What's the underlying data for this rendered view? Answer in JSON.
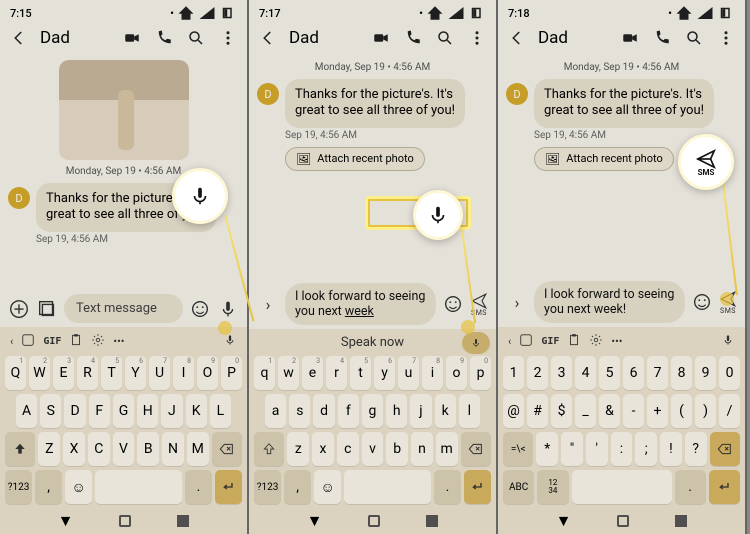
{
  "panels": [
    {
      "time": "7:15",
      "contact": "Dad",
      "timestamp": "Monday, Sep 19 • 4:56 AM",
      "msg": "Thanks for the picture's. It's great to see all three of you!",
      "subtime": "Sep 19, 4:56 AM",
      "composer_text": "Text message",
      "kbd_mode": "upper",
      "kbd_top_text": "",
      "callout": "mic"
    },
    {
      "time": "7:17",
      "contact": "Dad",
      "timestamp": "Monday, Sep 19 • 4:56 AM",
      "msg": "Thanks for the picture's. It's great to see all three of you!",
      "subtime": "Sep 19, 4:56 AM",
      "chip": "Attach recent photo",
      "composer_text": "I look forward to seeing you next ",
      "composer_underline": "week",
      "kbd_mode": "lower",
      "kbd_top_text": "Speak now",
      "callout": "mic"
    },
    {
      "time": "7:18",
      "contact": "Dad",
      "timestamp": "Monday, Sep 19 • 4:56 AM",
      "msg": "Thanks for the picture's. It's great to see all three of you!",
      "subtime": "Sep 19, 4:56 AM",
      "chip": "Attach recent photo",
      "composer_text": "I look forward to seeing you next week!",
      "kbd_mode": "numsym",
      "kbd_top_text": "",
      "callout": "send"
    }
  ],
  "send_label": "SMS",
  "avatar_letter": "D",
  "key_sets": {
    "upper": {
      "r1": [
        [
          "Q",
          "1"
        ],
        [
          "W",
          "2"
        ],
        [
          "E",
          "3"
        ],
        [
          "R",
          "4"
        ],
        [
          "T",
          "5"
        ],
        [
          "Y",
          "6"
        ],
        [
          "U",
          "7"
        ],
        [
          "I",
          "8"
        ],
        [
          "O",
          "9"
        ],
        [
          "P",
          "0"
        ]
      ],
      "r2": [
        "A",
        "S",
        "D",
        "F",
        "G",
        "H",
        "J",
        "K",
        "L"
      ],
      "r3": [
        "Z",
        "X",
        "C",
        "V",
        "B",
        "N",
        "M"
      ],
      "mode_key": "?123"
    },
    "lower": {
      "r1": [
        [
          "q",
          "1"
        ],
        [
          "w",
          "2"
        ],
        [
          "e",
          "3"
        ],
        [
          "r",
          "4"
        ],
        [
          "t",
          "5"
        ],
        [
          "y",
          "6"
        ],
        [
          "u",
          "7"
        ],
        [
          "i",
          "8"
        ],
        [
          "o",
          "9"
        ],
        [
          "p",
          "0"
        ]
      ],
      "r2": [
        "a",
        "s",
        "d",
        "f",
        "g",
        "h",
        "j",
        "k",
        "l"
      ],
      "r3": [
        "z",
        "x",
        "c",
        "v",
        "b",
        "n",
        "m"
      ],
      "mode_key": "?123"
    },
    "numsym": {
      "r1": [
        [
          "1",
          ""
        ],
        [
          "2",
          ""
        ],
        [
          "3",
          ""
        ],
        [
          "4",
          ""
        ],
        [
          "5",
          ""
        ],
        [
          "6",
          ""
        ],
        [
          "7",
          ""
        ],
        [
          "8",
          ""
        ],
        [
          "9",
          ""
        ],
        [
          "0",
          ""
        ]
      ],
      "r2": [
        "@",
        "#",
        "$",
        "_",
        "&",
        "-",
        "+",
        "(",
        ")",
        "/"
      ],
      "r3": [
        "*",
        "\"",
        "'",
        ":",
        ";",
        "!",
        "?"
      ],
      "mode_key": "ABC",
      "shift_key": "=\\<",
      "extra_key": "12\n34"
    }
  },
  "toolbar_icons": [
    "sticker-icon",
    "gif-icon",
    "clipboard-icon",
    "settings-icon",
    "more-icon",
    "mic-icon"
  ]
}
